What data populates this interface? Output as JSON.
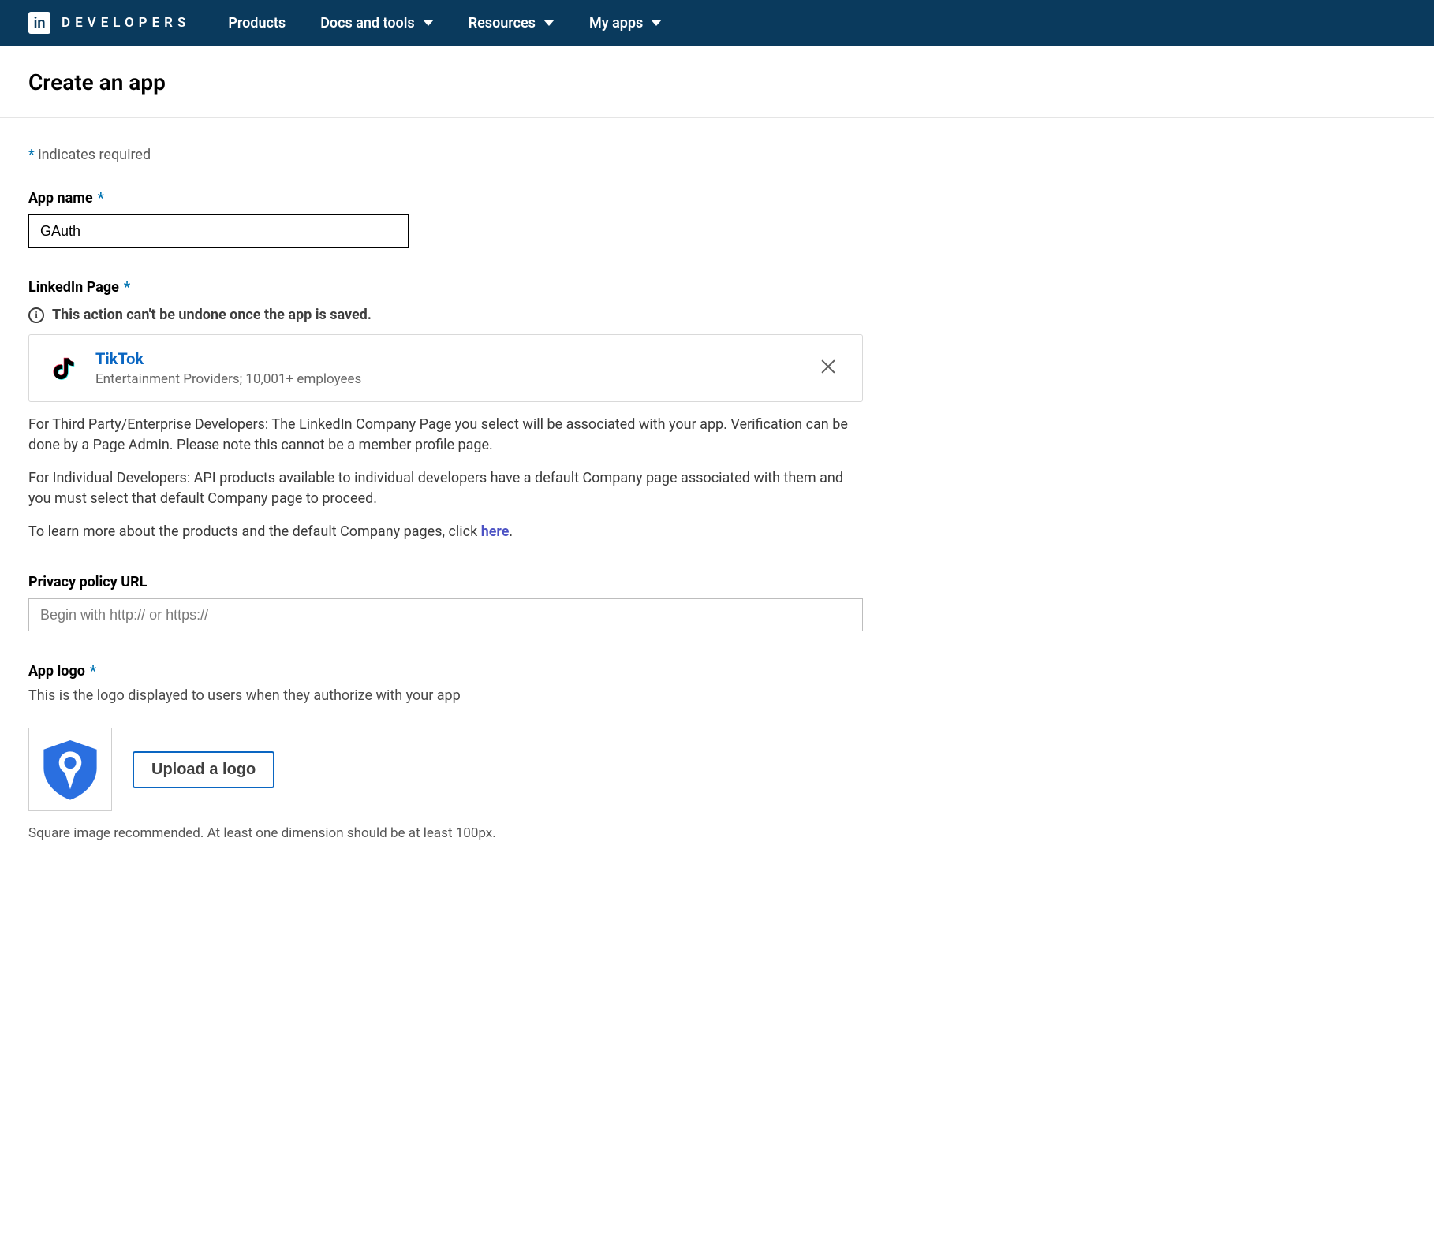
{
  "nav": {
    "brand_word": "DEVELOPERS",
    "brand_mark_text": "in",
    "items": [
      {
        "label": "Products",
        "has_caret": false
      },
      {
        "label": "Docs and tools",
        "has_caret": true
      },
      {
        "label": "Resources",
        "has_caret": true
      },
      {
        "label": "My apps",
        "has_caret": true
      }
    ]
  },
  "page": {
    "title": "Create an app",
    "required_note_prefix": "*",
    "required_note_text": " indicates required"
  },
  "app_name": {
    "label": "App name",
    "value": "GAuth"
  },
  "linkedin_page": {
    "label": "LinkedIn Page",
    "warning": "This action can't be undone once the app is saved.",
    "company": {
      "name": "TikTok",
      "subtitle": "Entertainment Providers; 10,001+ employees"
    },
    "help1": "For Third Party/Enterprise Developers: The LinkedIn Company Page you select will be associated with your app. Verification can be done by a Page Admin. Please note this cannot be a member profile page.",
    "help2": "For Individual Developers: API products available to individual developers have a default Company page associated with them and you must select that default Company page to proceed.",
    "help3_prefix": "To learn more about the products and the default Company pages, click ",
    "help3_link": "here",
    "help3_suffix": "."
  },
  "privacy": {
    "label": "Privacy policy URL",
    "placeholder": "Begin with http:// or https://",
    "value": ""
  },
  "logo": {
    "label": "App logo",
    "sub": "This is the logo displayed to users when they authorize with your app",
    "upload_label": "Upload a logo",
    "note": "Square image recommended. At least one dimension should be at least 100px."
  }
}
